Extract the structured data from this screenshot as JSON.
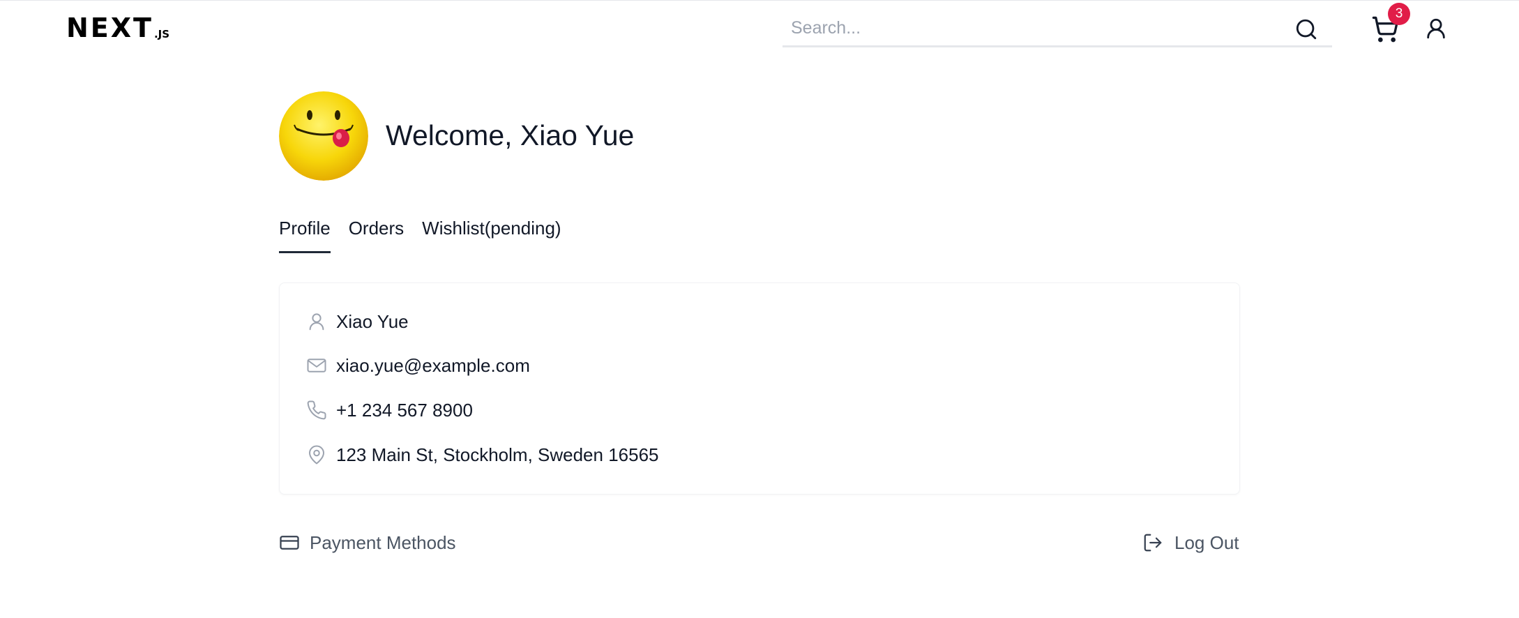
{
  "header": {
    "logo_main": "NEXT",
    "logo_sub": ".JS",
    "search_placeholder": "Search...",
    "cart_count": "3"
  },
  "profile": {
    "welcome": "Welcome, Xiao Yue",
    "tabs": [
      {
        "label": "Profile",
        "active": true
      },
      {
        "label": "Orders",
        "active": false
      },
      {
        "label": "Wishlist(pending)",
        "active": false
      }
    ],
    "name": "Xiao Yue",
    "email": "xiao.yue@example.com",
    "phone": "+1 234 567 8900",
    "address": "123 Main St, Stockholm, Sweden 16565"
  },
  "actions": {
    "payment_label": "Payment Methods",
    "logout_label": "Log Out"
  },
  "colors": {
    "badge": "#e11d48",
    "text": "#111827",
    "muted": "#4b5563",
    "icon_gray": "#9ca3af"
  }
}
